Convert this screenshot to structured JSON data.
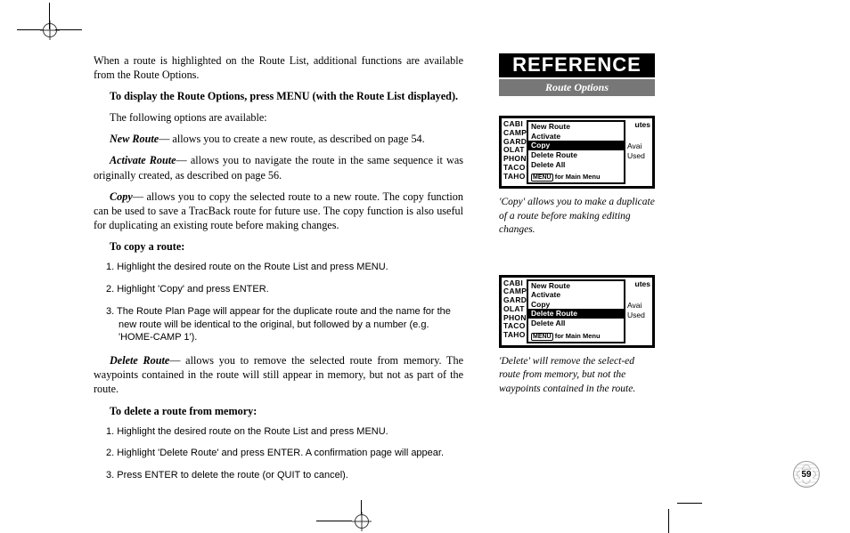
{
  "header": {
    "title": "REFERENCE",
    "subtitle": "Route Options"
  },
  "page_number": "59",
  "main": {
    "intro": "When a route is highlighted on the Route List, additional functions are available from the Route Options.",
    "display_instr": "To display the Route Options, press MENU (with the Route List displayed).",
    "following": "The following options are available:",
    "new_route_label": "New Route",
    "new_route_text": "— allows you to create a new route, as described on page 54.",
    "activate_label": "Activate Route",
    "activate_text": "— allows you to navigate the route in the same sequence it was originally created, as described on page 56.",
    "copy_label": "Copy",
    "copy_text": "— allows you to copy the selected route to a new route. The copy function can be used to save a TracBack route for future use. The copy function is also useful for duplicating an existing route before making changes.",
    "copy_heading": "To copy a route:",
    "copy_steps": [
      "1. Highlight the desired route on the Route List and press MENU.",
      "2. Highlight 'Copy' and press ENTER.",
      "3. The Route Plan Page will appear for the duplicate route and the name for the new route will be identical to the original, but followed by a number (e.g. 'HOME-CAMP 1')."
    ],
    "delete_label": "Delete Route",
    "delete_text": "— allows you to remove the selected route from memory. The waypoints contained in the route will still appear in memory, but not as part of the route.",
    "delete_heading": "To delete a route from memory:",
    "delete_steps": [
      "1. Highlight the desired route on the Route List and press MENU.",
      "2. Highlight 'Delete Route' and press ENTER. A confirmation page will appear.",
      "3. Press ENTER to delete the route (or QUIT to cancel)."
    ]
  },
  "side": {
    "fig_bg_labels": [
      "CABI",
      "CAMP",
      "GARD",
      "OLAT",
      "PHON",
      "TACO",
      "TAHO"
    ],
    "fig_right_top": "utes",
    "fig_right_vals": [
      "Avai",
      "Used"
    ],
    "menu_items": [
      "New Route",
      "Activate",
      "Copy",
      "Delete Route",
      "Delete All"
    ],
    "menu_btn": "MENU",
    "menu_footer_text": "for Main Menu",
    "caption1": "'Copy' allows you to make a duplicate of a route before making editing changes.",
    "caption2": "'Delete' will remove the select-ed route from memory, but not the waypoints contained in the route."
  }
}
